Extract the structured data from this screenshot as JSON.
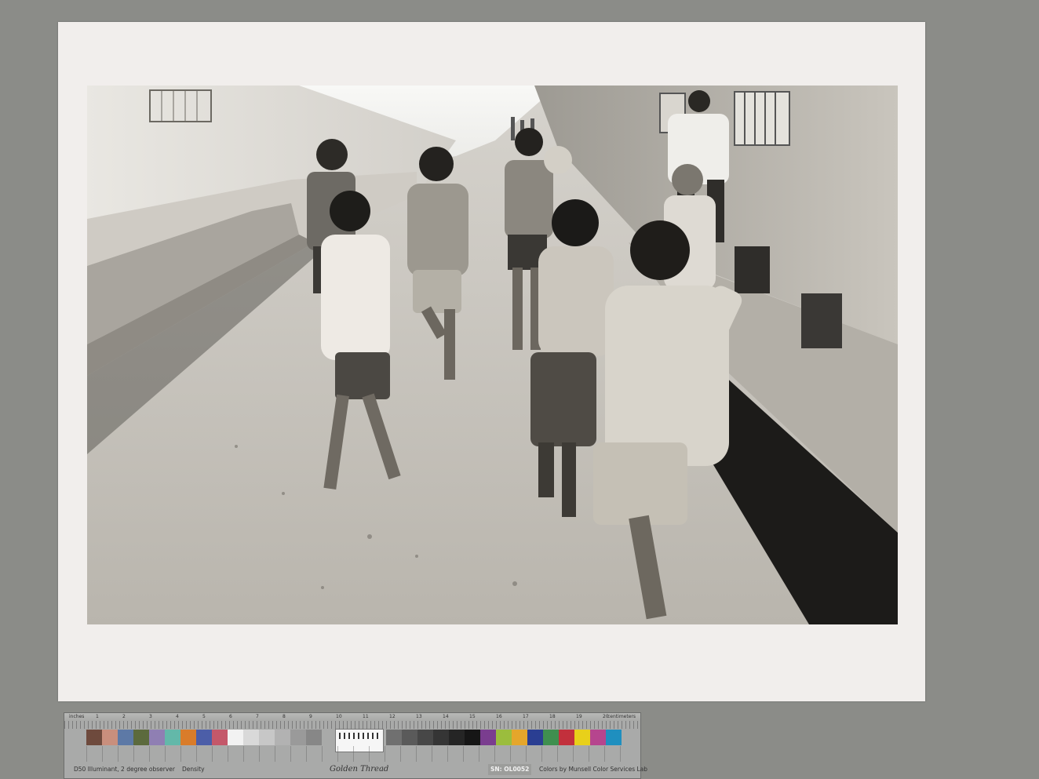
{
  "photo": {
    "subject": "children-playing-in-street",
    "tone": "black-and-white"
  },
  "color_target": {
    "top_left_label": "inches",
    "top_right_label": "centimeters",
    "ruler_marks": [
      "1",
      "2",
      "3",
      "4",
      "5",
      "6",
      "7",
      "8",
      "9",
      "10",
      "11",
      "12",
      "13",
      "14",
      "15",
      "16",
      "17",
      "18",
      "19",
      "20"
    ],
    "illuminant": "D50 Illuminant, 2 degree observer",
    "density_label": "Density",
    "brand": "Golden Thread",
    "serial": "SN: OL0052",
    "credit": "Colors by Munsell Color Services Lab",
    "patch_colors": [
      "#6e4a3d",
      "#c98f7d",
      "#5d79a6",
      "#5c6a3d",
      "#8f7fb3",
      "#63b8a9",
      "#d97c2a",
      "#4c5ea8",
      "#c4586a",
      "#f2f2f2",
      "#d9d9d9",
      "#c7c7c7",
      "#b2b2b2",
      "#9a9a9a",
      "#878787"
    ],
    "gray_patch_colors": [
      "#707070",
      "#5a5a5a",
      "#474747",
      "#353535",
      "#252525",
      "#161616",
      "#7a3d8f",
      "#9bbd3d",
      "#e5a62b",
      "#2a3e92",
      "#3f8f4f",
      "#c2303c",
      "#e8d01a",
      "#b6458e",
      "#1f8fbf"
    ]
  }
}
